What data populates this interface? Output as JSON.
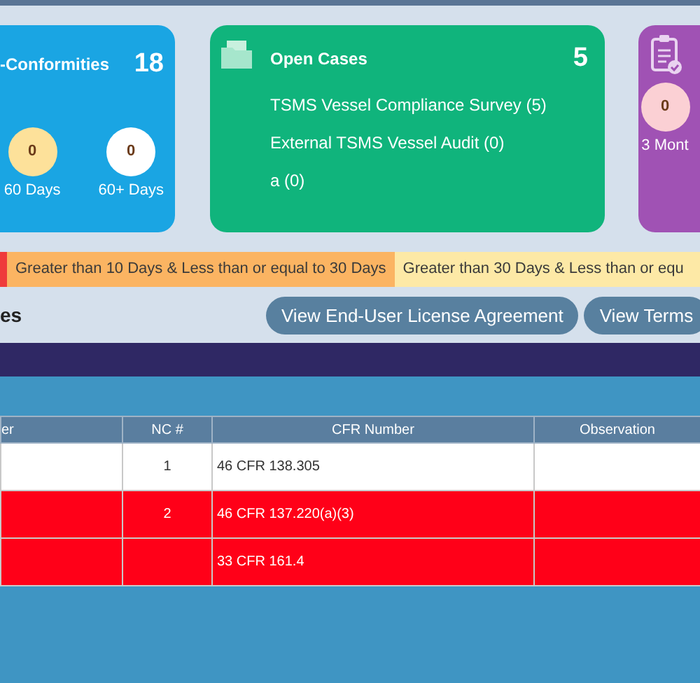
{
  "cards": [
    {
      "kind": "buckets",
      "color": "#1aa5e3",
      "title": "-Conformities",
      "count": "18",
      "buckets": [
        {
          "value": "0",
          "label": "60 Days",
          "color": "#fde19a"
        },
        {
          "value": "0",
          "label": "60+ Days",
          "color": "#ffffff"
        }
      ]
    },
    {
      "kind": "list",
      "color": "#10b47c",
      "title": "Open Cases",
      "count": "5",
      "items": [
        "TSMS Vessel Compliance Survey (5)",
        "External TSMS Vessel Audit (0)",
        "a (0)"
      ]
    },
    {
      "kind": "buckets",
      "color": "#a052b4",
      "buckets": [
        {
          "value": "0",
          "label": "3 Mont",
          "color": "#fbd0d4"
        }
      ]
    }
  ],
  "legend": [
    {
      "color": "#ef3b3b"
    },
    {
      "label": "Greater than 10 Days & Less than or equal to 30 Days",
      "color": "#fbb462"
    },
    {
      "label": "Greater than 30 Days & Less than or equ",
      "color": "#fde9a6"
    }
  ],
  "section_heading": "es",
  "buttons": [
    "View End-User License Agreement",
    "View Terms"
  ],
  "table": {
    "columns": [
      "er",
      "NC #",
      "CFR Number",
      "Observation"
    ],
    "rows": [
      {
        "color": "#ffffff",
        "nc": "1",
        "cfr": "46 CFR 138.305"
      },
      {
        "color": "#ff0018",
        "nc": "2",
        "cfr": "46 CFR 137.220(a)(3)"
      },
      {
        "color": "#ff0018",
        "cfr": "33 CFR 161.4"
      }
    ]
  }
}
